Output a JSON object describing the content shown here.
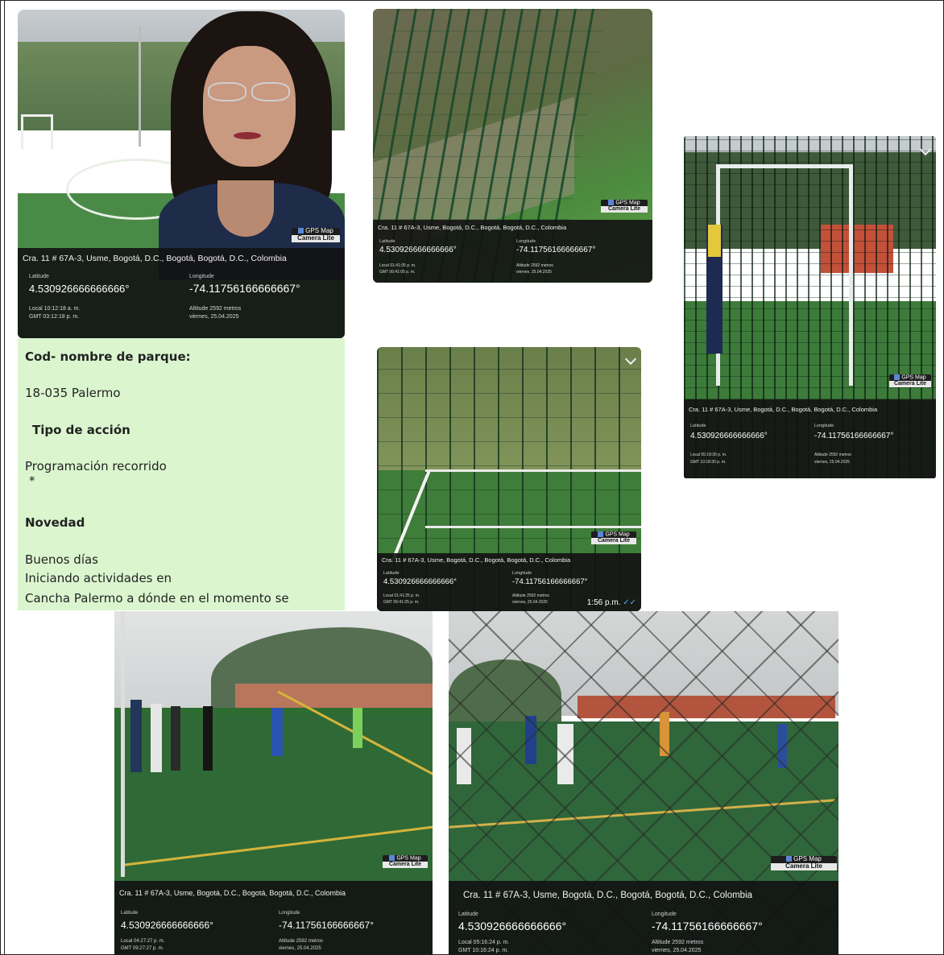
{
  "gps": {
    "address": "Cra. 11 # 67A-3, Usme, Bogotá, D.C., Bogotá, Bogotá, D.C., Colombia",
    "latitude_label": "Latitude",
    "longitude_label": "Longitude",
    "latitude": "4.530926666666666°",
    "longitude": "-74.11756166666667°",
    "altitude": "Altitude 2592 metros",
    "date": "viernes, 25.04.2025",
    "badge_top": "GPS Map",
    "badge_bottom": "Camera Lite"
  },
  "photos": [
    {
      "local": "Local 10:12:18 a. m.",
      "gmt": "GMT 03:12:18 p. m."
    },
    {
      "local": "Local 01:41:05 p. m.",
      "gmt": "GMT 06:41:05 p. m."
    },
    {
      "local": "Local 05:18:30 p. m.",
      "gmt": "GMT 10:18:30 p. m."
    },
    {
      "local": "Local 01:41:25 p. m.",
      "gmt": "GMT 06:41:25 p. m.",
      "time": "1:56 p.m."
    },
    {
      "local": "Local 04:27:27 p. m.",
      "gmt": "GMT 09:27:27 p. m."
    },
    {
      "local": "Local 05:16:24 p. m.",
      "gmt": "GMT 10:16:24 p. m."
    }
  ],
  "notes": {
    "park_heading": "Cod- nombre de parque:",
    "park_value": "18-035 Palermo",
    "action_heading": "Tipo de acción",
    "action_value": "Programación recorrido",
    "asterisk": "*",
    "novedad_heading": "Novedad",
    "line1": "Buenos días",
    "line2": "Iniciando actividades en",
    "line3": " Cancha Palermo a dónde en el momento se"
  },
  "colors": {
    "notes_bg": "#dbf6cf",
    "turf": "#3f7a3a",
    "overlay": "#121212"
  }
}
